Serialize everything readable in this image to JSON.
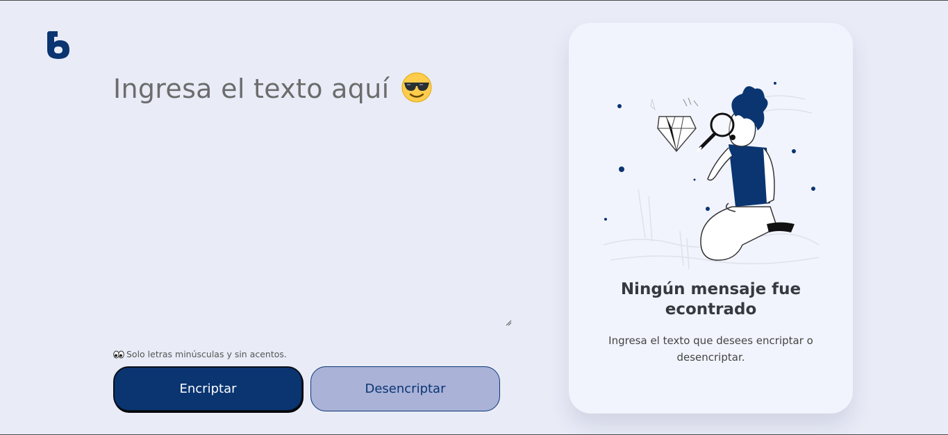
{
  "brand": {
    "logo_icon": "alura-logo-icon",
    "color": "#0a3571"
  },
  "input": {
    "placeholder": "Ingresa el texto aquí",
    "emoji_icon": "sunglasses-emoji-icon",
    "value": ""
  },
  "hint": {
    "icon": "eyes-icon",
    "text": "Solo letras minúsculas y sin acentos."
  },
  "buttons": {
    "encrypt": "Encriptar",
    "decrypt": "Desencriptar"
  },
  "output_card": {
    "illustration": "person-with-magnifier-illustration",
    "title": "Ningún mensaje fue econtrado",
    "text": "Ingresa el texto que desees encriptar o desencriptar."
  },
  "colors": {
    "background": "#e9ecf7",
    "primary": "#0a3571",
    "secondary": "#aab2d8",
    "card": "#f2f4fd"
  }
}
